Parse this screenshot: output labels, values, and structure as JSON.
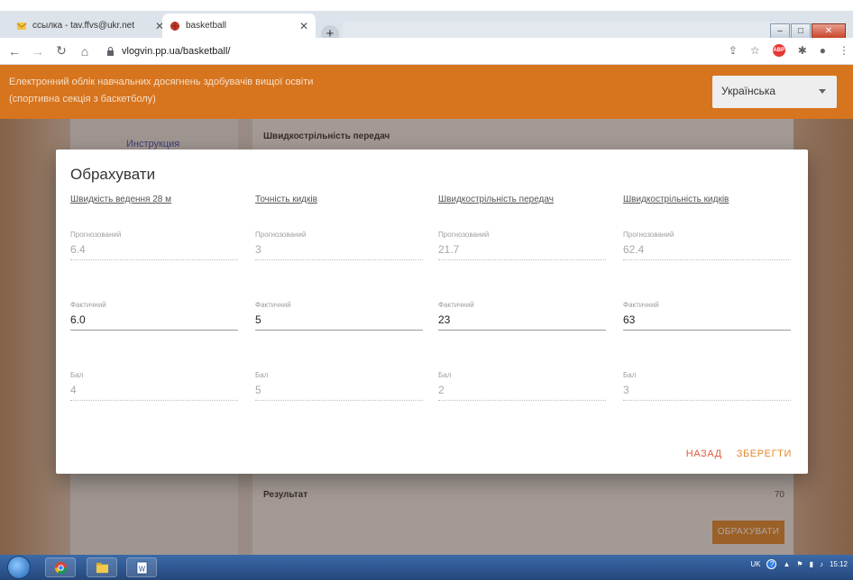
{
  "browser": {
    "tabs": [
      {
        "label": "ссылка - tav.ffvs@ukr.net"
      },
      {
        "label": "basketball"
      }
    ],
    "url": "vlogvin.pp.ua/basketball/"
  },
  "site": {
    "title_line1": "Електронний облік навчальних досягнень здобувачів вищої освіти",
    "title_line2": "(спортивна секція з баскетболу)",
    "language": "Українська"
  },
  "background": {
    "instruction": "Инструкция",
    "section_title": "Швидкострільність передач",
    "result_label": "Результат",
    "result_value": "70",
    "calc_button": "ОБРАХУВАТИ"
  },
  "modal": {
    "title": "Обрахувати",
    "labels": {
      "predicted": "Прогнозований",
      "actual": "Фактичний",
      "score": "Бал"
    },
    "columns": [
      {
        "header": "Швидкість ведення 28 м",
        "predicted": "6.4",
        "actual": "6.0",
        "score": "4"
      },
      {
        "header": "Точність кидків",
        "predicted": "3",
        "actual": "5",
        "score": "5"
      },
      {
        "header": "Швидкострільність передач",
        "predicted": "21.7",
        "actual": "23",
        "score": "2"
      },
      {
        "header": "Швидкострільність кидків",
        "predicted": "62.4",
        "actual": "63",
        "score": "3"
      }
    ],
    "back_button": "НАЗАД",
    "save_button": "ЗБЕРЕГТИ"
  },
  "taskbar": {
    "lang": "UK",
    "time": "15:12"
  },
  "colors": {
    "header_orange": "#d7741e",
    "accent_orange": "#e0892e",
    "back_red": "#e05a3e"
  }
}
